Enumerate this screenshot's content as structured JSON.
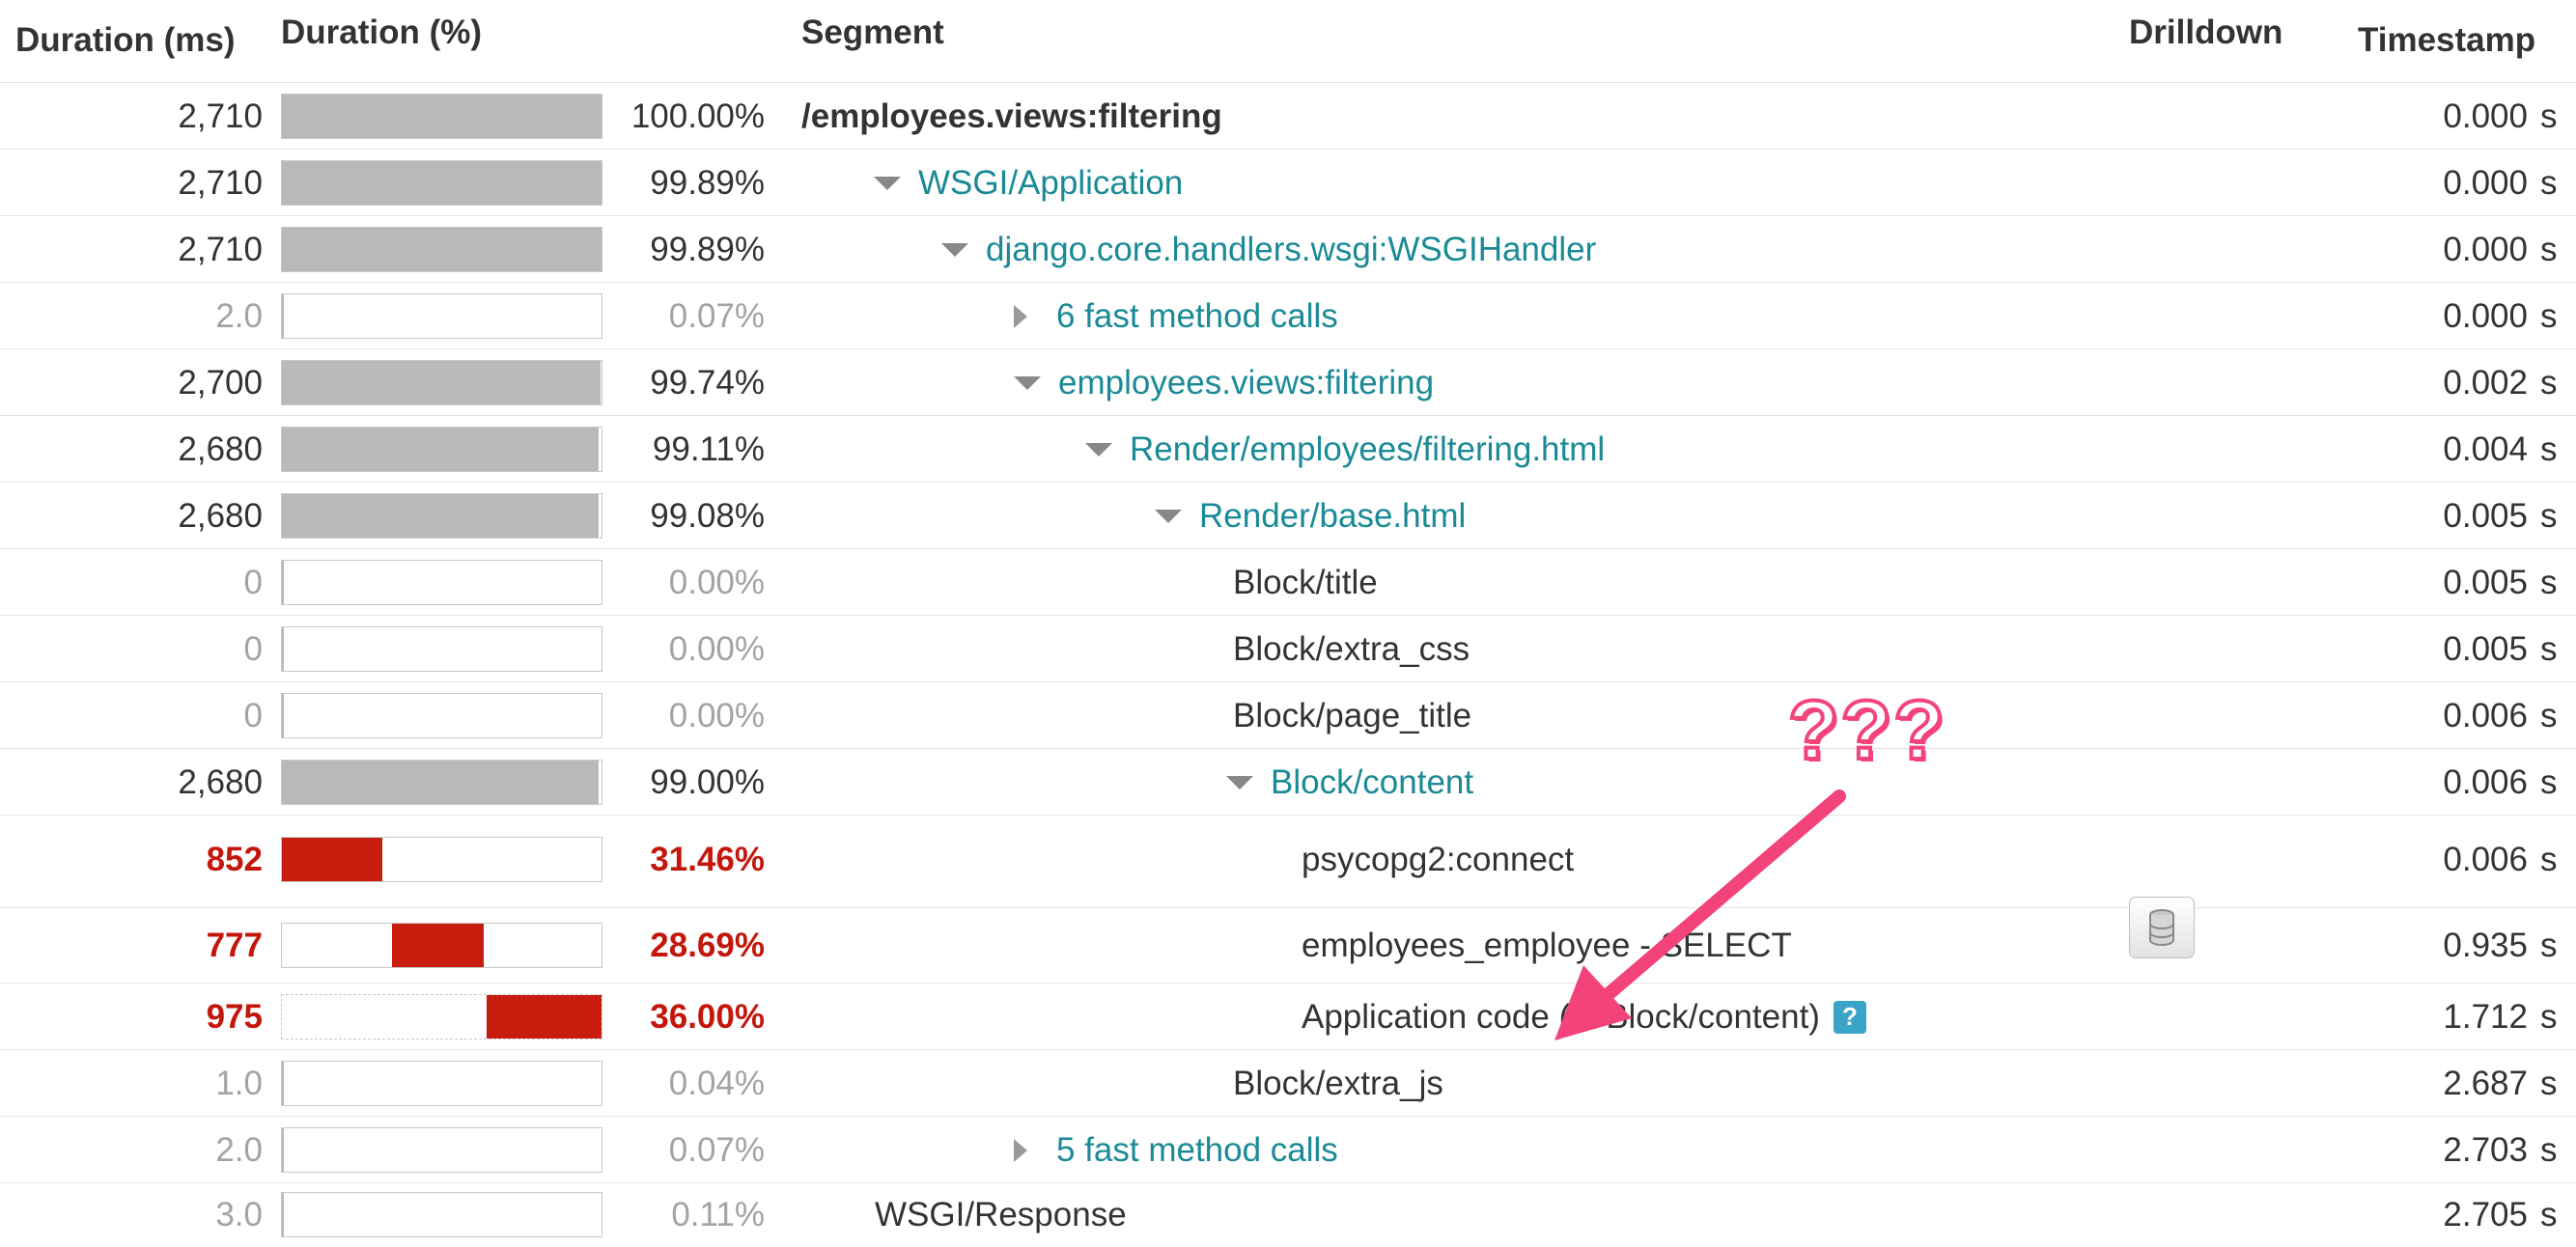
{
  "header": {
    "duration_ms": "Duration (ms)",
    "duration_pct": "Duration (%)",
    "segment": "Segment",
    "drilldown": "Drilldown",
    "timestamp": "Timestamp"
  },
  "rows": [
    {
      "ms": "2,710",
      "pct": "100.00%",
      "fill": 1.0,
      "offset": 0,
      "segment": "/employees.views:filtering",
      "ts": "0.000",
      "unit": "s"
    },
    {
      "ms": "2,710",
      "pct": "99.89%",
      "fill": 0.9989,
      "offset": 0,
      "segment": "WSGI/Application",
      "ts": "0.000",
      "unit": "s"
    },
    {
      "ms": "2,710",
      "pct": "99.89%",
      "fill": 0.9989,
      "offset": 0,
      "segment": "django.core.handlers.wsgi:WSGIHandler",
      "ts": "0.000",
      "unit": "s"
    },
    {
      "ms": "2.0",
      "pct": "0.07%",
      "fill": 0.0007,
      "offset": 0,
      "segment": "6 fast method calls",
      "ts": "0.000",
      "unit": "s"
    },
    {
      "ms": "2,700",
      "pct": "99.74%",
      "fill": 0.9974,
      "offset": 0,
      "segment": "employees.views:filtering",
      "ts": "0.002",
      "unit": "s"
    },
    {
      "ms": "2,680",
      "pct": "99.11%",
      "fill": 0.9911,
      "offset": 0,
      "segment": "Render/employees/filtering.html",
      "ts": "0.004",
      "unit": "s"
    },
    {
      "ms": "2,680",
      "pct": "99.08%",
      "fill": 0.9908,
      "offset": 0,
      "segment": "Render/base.html",
      "ts": "0.005",
      "unit": "s"
    },
    {
      "ms": "0",
      "pct": "0.00%",
      "fill": 0,
      "offset": 0,
      "segment": "Block/title",
      "ts": "0.005",
      "unit": "s"
    },
    {
      "ms": "0",
      "pct": "0.00%",
      "fill": 0,
      "offset": 0,
      "segment": "Block/extra_css",
      "ts": "0.005",
      "unit": "s"
    },
    {
      "ms": "0",
      "pct": "0.00%",
      "fill": 0,
      "offset": 0,
      "segment": "Block/page_title",
      "ts": "0.006",
      "unit": "s"
    },
    {
      "ms": "2,680",
      "pct": "99.00%",
      "fill": 0.99,
      "offset": 0,
      "segment": "Block/content",
      "ts": "0.006",
      "unit": "s"
    },
    {
      "ms": "852",
      "pct": "31.46%",
      "fill": 0.3146,
      "offset": 0,
      "segment": "psycopg2:connect",
      "ts": "0.006",
      "unit": "s"
    },
    {
      "ms": "777",
      "pct": "28.69%",
      "fill": 0.2869,
      "offset": 0.3453,
      "segment": "employees_employee - SELECT",
      "ts": "0.935",
      "unit": "s"
    },
    {
      "ms": "975",
      "pct": "36.00%",
      "fill": 0.36,
      "offset": 0.64,
      "segment": "Application code (in Block/content)",
      "ts": "1.712",
      "unit": "s"
    },
    {
      "ms": "1.0",
      "pct": "0.04%",
      "fill": 0.0004,
      "offset": 0,
      "segment": "Block/extra_js",
      "ts": "2.687",
      "unit": "s"
    },
    {
      "ms": "2.0",
      "pct": "0.07%",
      "fill": 0.0007,
      "offset": 0,
      "segment": "5 fast method calls",
      "ts": "2.703",
      "unit": "s"
    },
    {
      "ms": "3.0",
      "pct": "0.11%",
      "fill": 0.0011,
      "offset": 0,
      "segment": "WSGI/Response",
      "ts": "2.705",
      "unit": "s"
    }
  ],
  "annotation": "???",
  "help_icon_glyph": "?",
  "colors": {
    "bar_gray": "#b9b9b9",
    "bar_red": "#c81c0e",
    "link_teal": "#1a8a96",
    "annotation_pink": "#f2437a"
  }
}
